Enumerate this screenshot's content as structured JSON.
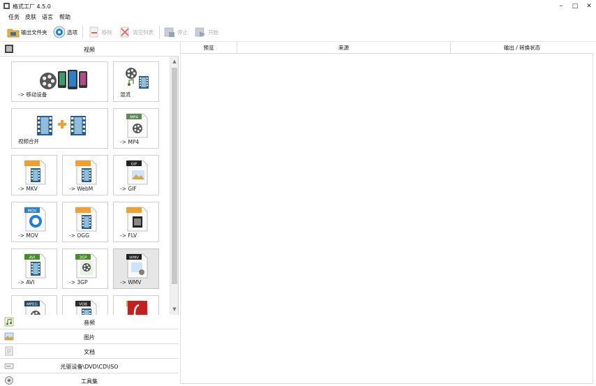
{
  "window": {
    "title": "格式工厂 4.5.0",
    "minimize": "–",
    "maximize": "□",
    "close": "✕"
  },
  "menu": [
    "任务",
    "皮肤",
    "语言",
    "帮助"
  ],
  "toolbar": {
    "output_folder": "输出文件夹",
    "options": "选项",
    "remove": "移除",
    "clear_list": "清空列表",
    "stop": "停止",
    "start": "开始"
  },
  "left": {
    "video_header": "视频",
    "tiles": [
      {
        "label": "-> 移动设备",
        "icon": "mobile-device-icon"
      },
      {
        "label": "混流",
        "icon": "mux-icon"
      },
      {
        "label": "视频合并",
        "icon": "video-join-icon"
      },
      {
        "label": "-> MP4",
        "icon": "mp4-icon",
        "badge": "MP4"
      },
      {
        "label": "-> MKV",
        "icon": "mkv-icon",
        "badge": ""
      },
      {
        "label": "-> WebM",
        "icon": "webm-icon",
        "badge": ""
      },
      {
        "label": "-> GIF",
        "icon": "gif-icon",
        "badge": "GIF"
      },
      {
        "label": "-> MOV",
        "icon": "mov-icon",
        "badge": "MOV"
      },
      {
        "label": "-> OGG",
        "icon": "ogg-icon",
        "badge": ""
      },
      {
        "label": "-> FLV",
        "icon": "flv-icon",
        "badge": ""
      },
      {
        "label": "-> AVI",
        "icon": "avi-icon",
        "badge": "AVI"
      },
      {
        "label": "-> 3GP",
        "icon": "3gp-icon",
        "badge": "3GP"
      },
      {
        "label": "-> WMV",
        "icon": "wmv-icon",
        "badge": "WMV"
      },
      {
        "label": "",
        "icon": "mpeg-icon",
        "badge": "MPEG"
      },
      {
        "label": "",
        "icon": "vob-icon",
        "badge": "VOB"
      },
      {
        "label": "",
        "icon": "swf-icon",
        "badge": ""
      }
    ],
    "categories": [
      "音频",
      "图片",
      "文档",
      "光驱设备\\DVD\\CD\\ISO",
      "工具集"
    ]
  },
  "table": {
    "columns": [
      "预览",
      "来源",
      "输出 / 转换状态"
    ]
  },
  "colors": {
    "film": "#2a5d8a",
    "film_frame": "#8fbde0",
    "orange": "#f0a030",
    "accent_blue": "#1f7fd4",
    "disabled": "#b0b0b0"
  }
}
